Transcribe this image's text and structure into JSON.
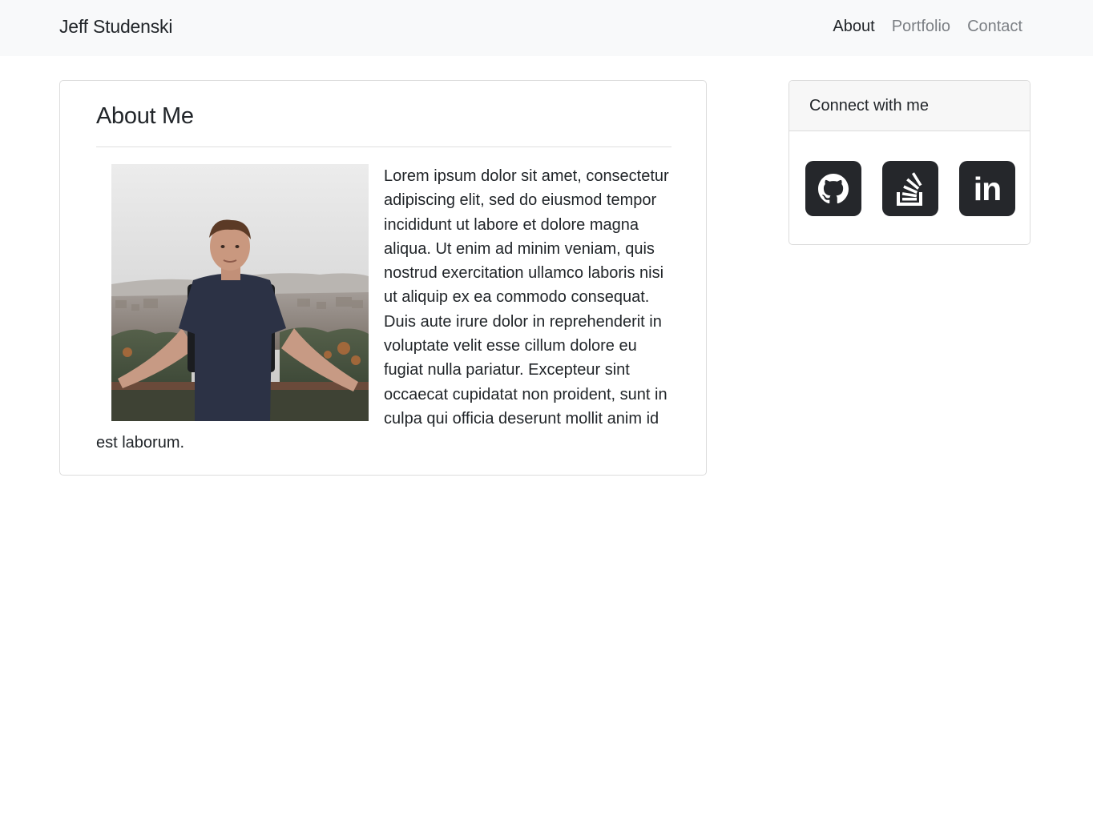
{
  "navbar": {
    "brand": "Jeff Studenski",
    "links": [
      {
        "label": "About",
        "active": true
      },
      {
        "label": "Portfolio",
        "active": false
      },
      {
        "label": "Contact",
        "active": false
      }
    ]
  },
  "about": {
    "title": "About Me",
    "body": "Lorem ipsum dolor sit amet, consectetur adipiscing elit, sed do eiusmod tempor incididunt ut labore et dolore magna aliqua. Ut enim ad minim veniam, quis nostrud exercitation ullamco laboris nisi ut aliquip ex ea commodo consequat. Duis aute irure dolor in reprehenderit in voluptate velit esse cillum dolore eu fugiat nulla pariatur. Excepteur sint occaecat cupidatat non proident, sunt in culpa qui officia deserunt mollit anim id est laborum."
  },
  "connect": {
    "header": "Connect with me",
    "icons": [
      "github-icon",
      "stackoverflow-icon",
      "linkedin-icon"
    ],
    "linkedin_text": "in"
  },
  "colors": {
    "navbar_bg": "#f8f9fa",
    "icon_bg": "#25272b",
    "muted_link": "#7b7f84",
    "text": "#212529"
  }
}
